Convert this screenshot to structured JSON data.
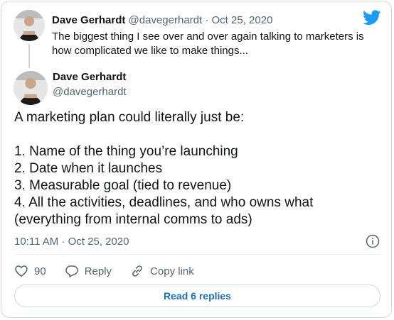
{
  "parent_tweet": {
    "author_name": "Dave Gerhardt",
    "handle": "@davegerhardt",
    "separator": "·",
    "date": "Oct 25, 2020",
    "text": "The biggest thing I see over and over again talking to marketers is how complicated we like to make things..."
  },
  "main_tweet": {
    "author_name": "Dave Gerhardt",
    "handle": "@davegerhardt",
    "lines": [
      "A marketing plan could literally just be:",
      "",
      "1. Name of the thing you’re launching",
      "2. Date when it launches",
      "3. Measurable goal (tied to revenue)",
      "4. All the activities, deadlines, and who owns what (everything from internal comms to ads)"
    ],
    "timestamp": "10:11 AM · Oct 25, 2020"
  },
  "actions": {
    "like_count": "90",
    "reply_label": "Reply",
    "copy_link_label": "Copy link"
  },
  "read_replies_label": "Read 6 replies",
  "colors": {
    "brand_blue": "#1d9bf0",
    "link_blue": "#1d70b8",
    "muted_text": "#536471",
    "border": "#cfd9de"
  },
  "icons": [
    "twitter-bird-icon",
    "info-icon",
    "heart-icon",
    "reply-icon",
    "link-icon"
  ]
}
